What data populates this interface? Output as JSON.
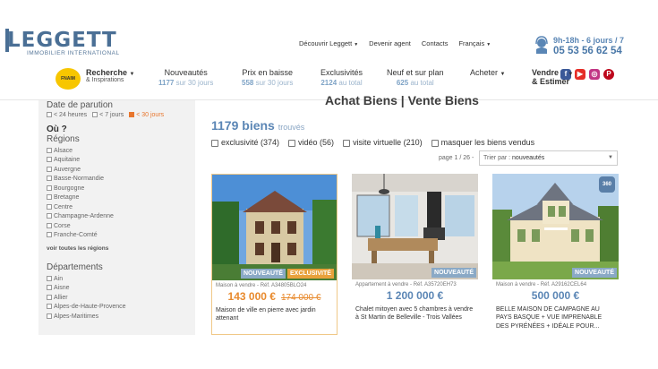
{
  "brand": {
    "name": "LEGGETT",
    "tagline": "IMMOBILIER INTERNATIONAL"
  },
  "topnav": [
    "Découvrir Leggett",
    "Devenir agent",
    "Contacts",
    "Français"
  ],
  "contact": {
    "hours": "9h-18h - 6 jours / 7",
    "phone": "05 53 56 62 54"
  },
  "socials": [
    "facebook-icon",
    "youtube-icon",
    "instagram-icon",
    "pinterest-icon"
  ],
  "fnaim": "FNAIM",
  "mainnav": {
    "recherche": "Recherche",
    "recherche_sub": "& Inspirations",
    "items": [
      {
        "label": "Nouveautés",
        "num": "1177",
        "rest": "sur 30 jours"
      },
      {
        "label": "Prix en baisse",
        "num": "558",
        "rest": "sur 30 jours"
      },
      {
        "label": "Exclusivités",
        "num": "2124",
        "rest": "au total"
      },
      {
        "label": "Neuf et sur plan",
        "num": "625",
        "rest": "au total"
      }
    ],
    "acheter": "Acheter",
    "vendre1": "Vendre",
    "vendre2": "& Estimer"
  },
  "sidebar": {
    "date_title": "Date de parution",
    "date_opts": [
      "< 24 heures",
      "< 7 jours",
      "< 30 jours"
    ],
    "ou_title": "Où ?",
    "regions_title": "Régions",
    "regions": [
      "Alsace",
      "Aquitaine",
      "Auvergne",
      "Basse-Normandie",
      "Bourgogne",
      "Bretagne",
      "Centre",
      "Champagne-Ardenne",
      "Corse",
      "Franche-Comté"
    ],
    "see_all": "voir toutes les régions",
    "depts_title": "Départements",
    "depts": [
      "Ain",
      "Aisne",
      "Allier",
      "Alpes-de-Haute-Provence",
      "Alpes-Maritimes"
    ]
  },
  "main": {
    "title": "Achat Biens | Vente Biens",
    "count": "1179 biens",
    "count_suffix": "trouvés",
    "filters": [
      "exclusivité (374)",
      "vidéo (56)",
      "visite virtuelle (210)",
      "masquer les biens vendus"
    ],
    "pageinfo": "page 1 / 26 -",
    "sort_label": "Trier par :",
    "sort_value": "nouveautés"
  },
  "cards": [
    {
      "ref": "Maison à vendre - Réf. A34805BLO24",
      "price": "143 000 €",
      "old_price": "174 000 €",
      "desc": "Maison de ville en pierre avec jardin attenant",
      "badges": [
        "NOUVEAUTÉ",
        "EXCLUSIVITÉ"
      ]
    },
    {
      "ref": "Appartement à vendre - Réf. A35720EH73",
      "price": "1 200 000 €",
      "desc": "Chalet mitoyen avec 5 chambres à vendre à St Martin de Belleville - Trois Vallées",
      "badges": [
        "NOUVEAUTÉ"
      ]
    },
    {
      "ref": "Maison à vendre - Réf. A29162CEL64",
      "price": "500 000 €",
      "desc": "BELLE MAISON DE CAMPAGNE AU PAYS BASQUE + VUE IMPRENABLE DES PYRÉNÉES + IDÉALE POUR...",
      "badges": [
        "NOUVEAUTÉ"
      ],
      "tour": "360"
    }
  ]
}
